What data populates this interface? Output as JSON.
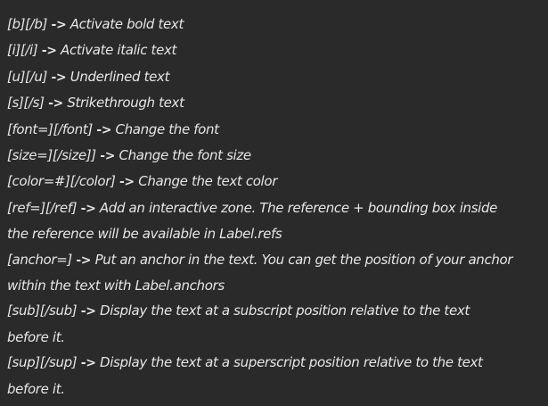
{
  "lines": [
    {
      "tag": "[b][/b]",
      "arrow": "->",
      "desc": "Activate bold text"
    },
    {
      "tag": "[i][/i]",
      "arrow": "->",
      "desc": "Activate italic text"
    },
    {
      "tag": "[u][/u]",
      "arrow": "->",
      "desc": "Underlined text"
    },
    {
      "tag": "[s][/s]",
      "arrow": "->",
      "desc": "Strikethrough text"
    },
    {
      "tag": "[font=][/font]",
      "arrow": "->",
      "desc": "Change the font"
    },
    {
      "tag": "[size=][/size]]",
      "arrow": "->",
      "desc": "Change the font size"
    },
    {
      "tag": "[color=#][/color]",
      "arrow": "->",
      "desc": "Change the text color"
    },
    {
      "tag": "[ref=][/ref]",
      "arrow": "->",
      "desc": "Add an interactive zone. The reference + bounding box inside"
    },
    {
      "text": "the reference will be available in Label.refs"
    },
    {
      "tag": "[anchor=]",
      "arrow": "->",
      "desc": "Put an anchor in the text. You can get the position of your anchor"
    },
    {
      "text": "within the text with Label.anchors"
    },
    {
      "tag": "[sub][/sub]",
      "arrow": "->",
      "desc": "Display the text at a subscript position relative to the text"
    },
    {
      "text": "before it."
    },
    {
      "tag": "[sup][/sup]",
      "arrow": "->",
      "desc": "Display the text at a superscript position relative to the text"
    },
    {
      "text": "before it."
    }
  ]
}
